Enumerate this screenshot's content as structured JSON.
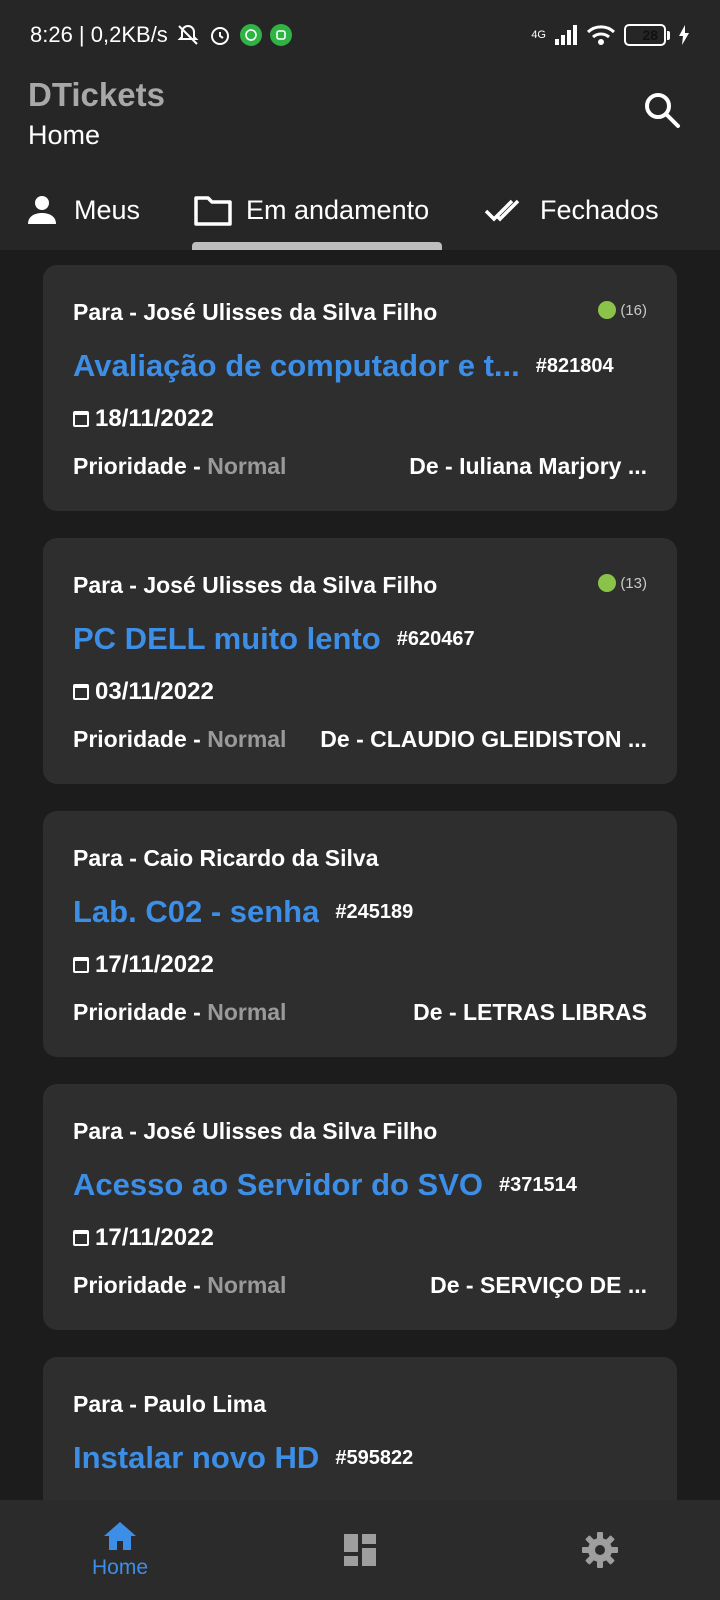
{
  "status_bar": {
    "time_speed": "8:26 | 0,2KB/s",
    "network": "4G",
    "battery": "28",
    "battery_level": 0.28
  },
  "app_bar": {
    "title": "DTickets",
    "subtitle": "Home"
  },
  "tabs": [
    {
      "label": "Meus",
      "icon": "person-icon",
      "selected": false
    },
    {
      "label": "Em andamento",
      "icon": "folder-icon",
      "selected": true
    },
    {
      "label": "Fechados",
      "icon": "double-check-icon",
      "selected": false
    }
  ],
  "tickets": [
    {
      "to": "Para - José Ulisses da Silva Filho",
      "count": "(16)",
      "title": "Avaliação de computador e t...",
      "number": "#821804",
      "date": "18/11/2022",
      "priority_label": "Prioridade - ",
      "priority": "Normal",
      "from": "De - Iuliana Marjory ..."
    },
    {
      "to": "Para - José Ulisses da Silva Filho",
      "count": "(13)",
      "title": "PC DELL muito lento",
      "number": "#620467",
      "date": "03/11/2022",
      "priority_label": "Prioridade - ",
      "priority": "Normal",
      "from": "De - CLAUDIO GLEIDISTON ..."
    },
    {
      "to": "Para - Caio Ricardo da Silva",
      "count": "",
      "title": "Lab. C02 - senha",
      "number": "#245189",
      "date": "17/11/2022",
      "priority_label": "Prioridade - ",
      "priority": "Normal",
      "from": "De - LETRAS LIBRAS"
    },
    {
      "to": "Para - José Ulisses da Silva Filho",
      "count": "",
      "title": "Acesso ao Servidor do SVO",
      "number": "#371514",
      "date": "17/11/2022",
      "priority_label": "Prioridade - ",
      "priority": "Normal",
      "from": "De - SERVIÇO DE ..."
    },
    {
      "to": "Para - Paulo Lima",
      "count": "",
      "title": "Instalar novo HD",
      "number": "#595822",
      "date": "",
      "priority_label": "",
      "priority": "",
      "from": ""
    }
  ],
  "bottom_nav": {
    "home_label": "Home"
  },
  "colors": {
    "accent": "#3d8ee6",
    "card": "#2e2e2e",
    "background": "#1c1c1c",
    "badge_dot": "#8bc34a"
  }
}
